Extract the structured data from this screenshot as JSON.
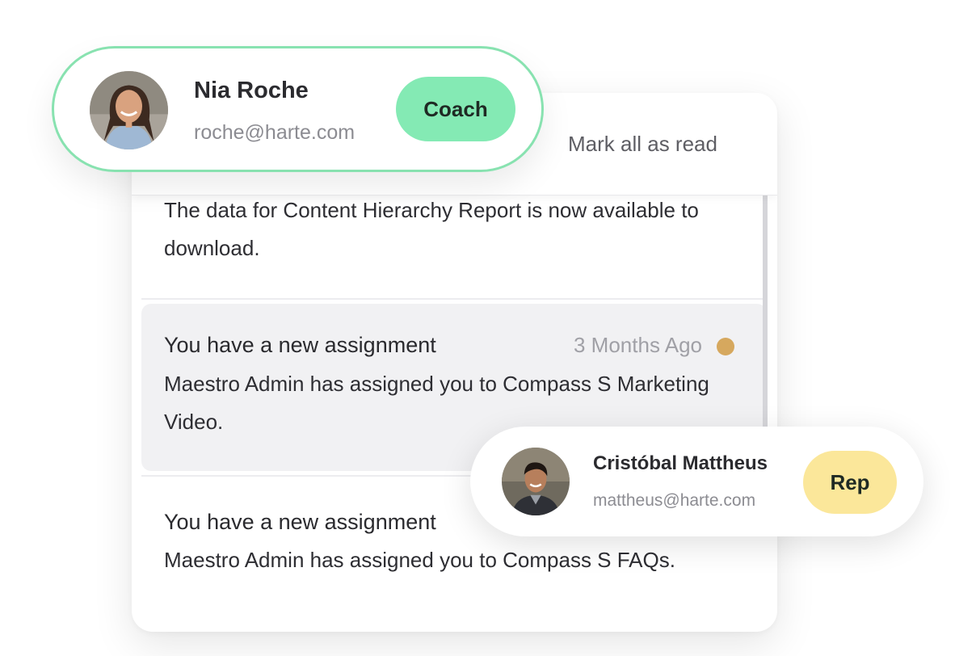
{
  "panel": {
    "mark_all_read_label": "Mark all as read",
    "notifications": [
      {
        "title": "",
        "body": "The data for Content Hierarchy Report is now available to download.",
        "time": "",
        "unread": false
      },
      {
        "title": "You have a new assignment",
        "body": "Maestro Admin has assigned you to Compass S Marketing Video.",
        "time": "3 Months Ago",
        "unread": true,
        "dot_color": "#d6a85e"
      },
      {
        "title": "You have a new assignment",
        "body": "Maestro Admin has assigned you to Compass S FAQs.",
        "time": "",
        "unread": false
      }
    ]
  },
  "users": {
    "coach": {
      "name": "Nia Roche",
      "email": "roche@harte.com",
      "role": "Coach",
      "role_color": "#84eab4",
      "border_color": "#88e2b0",
      "avatar": "user-photo-icon"
    },
    "rep": {
      "name": "Cristóbal Mattheus",
      "email": "mattheus@harte.com",
      "role": "Rep",
      "role_color": "#fbe79a",
      "avatar": "user-photo-icon"
    }
  }
}
